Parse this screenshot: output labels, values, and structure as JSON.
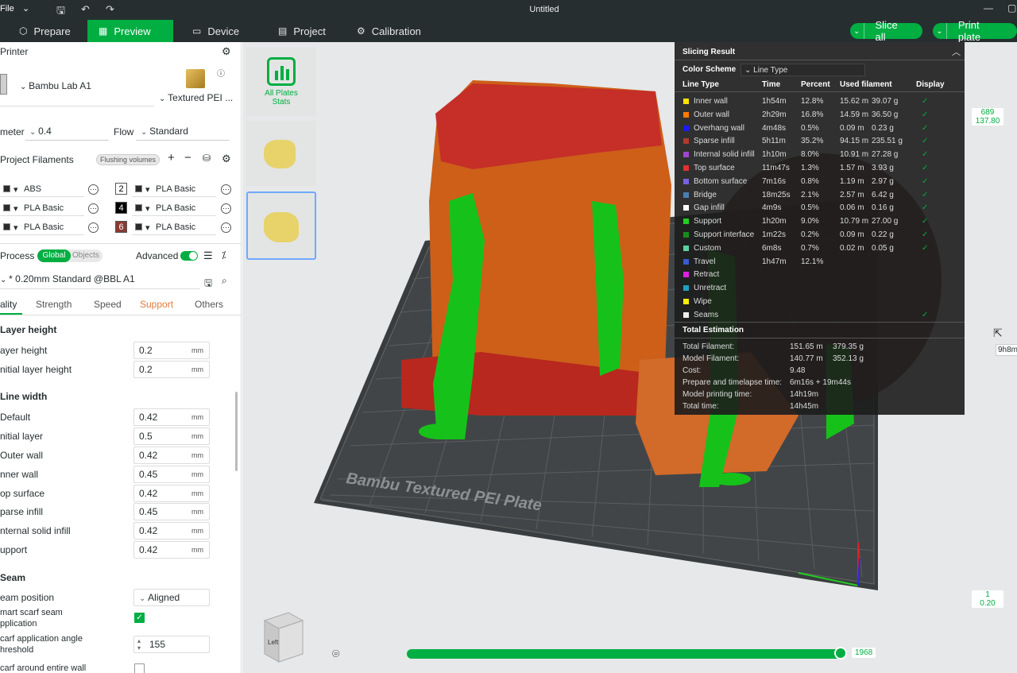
{
  "topbar": {
    "file": "File",
    "title": "Untitled"
  },
  "tabs": [
    "Prepare",
    "Preview",
    "Device",
    "Project",
    "Calibration"
  ],
  "actions": {
    "slice_all": "Slice all",
    "print_plate": "Print plate"
  },
  "printer": {
    "section": "Printer",
    "name": "Bambu Lab A1",
    "plate": "Textured PEI ...",
    "nozzle_label": "meter",
    "nozzle": "0.4",
    "flow_label": "Flow",
    "flow": "Standard"
  },
  "filaments": {
    "section": "Project Filaments",
    "flushing": "Flushing volumes",
    "items": [
      {
        "name": "ABS",
        "color": "#2a2a2a"
      },
      {
        "name": "PLA Basic",
        "color": "#2a2a2a",
        "num": "2",
        "num_color": "#ffffff"
      },
      {
        "name": "PLA Basic",
        "color": "#2a2a2a",
        "num": "4",
        "num_color": "#000000"
      },
      {
        "name": "PLA Basic",
        "color": "#2a2a2a"
      },
      {
        "name": "PLA Basic",
        "color": "#2a2a2a",
        "num": "6",
        "num_color": "#8a3a33"
      },
      {
        "name": "PLA Basic",
        "color": "#2a2a2a"
      }
    ]
  },
  "process": {
    "section": "Process",
    "global": "Global",
    "objects": "Objects",
    "advanced": "Advanced",
    "preset": "* 0.20mm Standard @BBL A1",
    "tabs": [
      "ality",
      "Strength",
      "Speed",
      "Support",
      "Others"
    ]
  },
  "params": {
    "layer_height": {
      "title": "Layer height",
      "rows": [
        {
          "label": "ayer height",
          "value": "0.2",
          "unit": "mm"
        },
        {
          "label": "nitial layer height",
          "value": "0.2",
          "unit": "mm"
        }
      ]
    },
    "line_width": {
      "title": "Line width",
      "rows": [
        {
          "label": "Default",
          "value": "0.42",
          "unit": "mm"
        },
        {
          "label": "nitial layer",
          "value": "0.5",
          "unit": "mm"
        },
        {
          "label": "Outer wall",
          "value": "0.42",
          "unit": "mm"
        },
        {
          "label": "nner wall",
          "value": "0.45",
          "unit": "mm"
        },
        {
          "label": "op surface",
          "value": "0.42",
          "unit": "mm"
        },
        {
          "label": "parse infill",
          "value": "0.45",
          "unit": "mm"
        },
        {
          "label": "nternal solid infill",
          "value": "0.42",
          "unit": "mm"
        },
        {
          "label": "upport",
          "value": "0.42",
          "unit": "mm"
        }
      ]
    },
    "seam": {
      "title": "Seam",
      "position_label": "eam position",
      "position": "Aligned",
      "scarf_label": "mart scarf seam",
      "scarf_label2": "pplication",
      "angle_label": "carf application angle",
      "angle_label2": "hreshold",
      "angle": "155",
      "around_label": "carf around entire wall"
    }
  },
  "plates": {
    "all_stats_1": "All Plates",
    "all_stats_2": "Stats"
  },
  "slicing": {
    "title": "Slicing Result",
    "scheme_label": "Color Scheme",
    "scheme": "Line Type",
    "headers": [
      "Line Type",
      "Time",
      "Percent",
      "Used filament",
      "Display"
    ],
    "rows": [
      {
        "name": "Inner wall",
        "color": "#ffe000",
        "time": "1h54m",
        "percent": "12.8%",
        "len": "15.62 m",
        "weight": "39.07 g",
        "display": true
      },
      {
        "name": "Outer wall",
        "color": "#ff7a00",
        "time": "2h29m",
        "percent": "16.8%",
        "len": "14.59 m",
        "weight": "36.50 g",
        "display": true
      },
      {
        "name": "Overhang wall",
        "color": "#1a1aff",
        "time": "4m48s",
        "percent": "0.5%",
        "len": "0.09 m",
        "weight": "0.23 g",
        "display": true
      },
      {
        "name": "Sparse infill",
        "color": "#b03a2e",
        "time": "5h11m",
        "percent": "35.2%",
        "len": "94.15 m",
        "weight": "235.51 g",
        "display": true
      },
      {
        "name": "Internal solid infill",
        "color": "#a045d0",
        "time": "1h10m",
        "percent": "8.0%",
        "len": "10.91 m",
        "weight": "27.28 g",
        "display": true
      },
      {
        "name": "Top surface",
        "color": "#e03030",
        "time": "11m47s",
        "percent": "1.3%",
        "len": "1.57 m",
        "weight": "3.93 g",
        "display": true
      },
      {
        "name": "Bottom surface",
        "color": "#7a5fe0",
        "time": "7m16s",
        "percent": "0.8%",
        "len": "1.19 m",
        "weight": "2.97 g",
        "display": true
      },
      {
        "name": "Bridge",
        "color": "#4a7fb0",
        "time": "18m25s",
        "percent": "2.1%",
        "len": "2.57 m",
        "weight": "6.42 g",
        "display": true
      },
      {
        "name": "Gap infill",
        "color": "#ffffff",
        "time": "4m9s",
        "percent": "0.5%",
        "len": "0.06 m",
        "weight": "0.16 g",
        "display": true
      },
      {
        "name": "Support",
        "color": "#22cc22",
        "time": "1h20m",
        "percent": "9.0%",
        "len": "10.79 m",
        "weight": "27.00 g",
        "display": true
      },
      {
        "name": "Support interface",
        "color": "#1a8a1a",
        "time": "1m22s",
        "percent": "0.2%",
        "len": "0.09 m",
        "weight": "0.22 g",
        "display": true
      },
      {
        "name": "Custom",
        "color": "#5fd0a0",
        "time": "6m8s",
        "percent": "0.7%",
        "len": "0.02 m",
        "weight": "0.05 g",
        "display": true
      },
      {
        "name": "Travel",
        "color": "#3a5ad0",
        "time": "1h47m",
        "percent": "12.1%",
        "len": "",
        "weight": "",
        "display": false
      },
      {
        "name": "Retract",
        "color": "#e020e0",
        "time": "",
        "percent": "",
        "len": "",
        "weight": "",
        "display": false
      },
      {
        "name": "Unretract",
        "color": "#20a0c0",
        "time": "",
        "percent": "",
        "len": "",
        "weight": "",
        "display": false
      },
      {
        "name": "Wipe",
        "color": "#ffee00",
        "time": "",
        "percent": "",
        "len": "",
        "weight": "",
        "display": false
      },
      {
        "name": "Seams",
        "color": "#eeeeee",
        "time": "",
        "percent": "",
        "len": "",
        "weight": "",
        "display": true
      }
    ],
    "total_title": "Total Estimation",
    "totals": [
      {
        "label": "Total Filament:",
        "value": "151.65 m",
        "value2": "379.35 g"
      },
      {
        "label": "Model Filament:",
        "value": "140.77 m",
        "value2": "352.13 g"
      },
      {
        "label": "Cost:",
        "value": "9.48",
        "value2": ""
      },
      {
        "label": "Prepare and timelapse time:",
        "value": "6m16s + 19m44s",
        "value2": ""
      },
      {
        "label": "Model printing time:",
        "value": "14h19m",
        "value2": ""
      },
      {
        "label": "Total time:",
        "value": "14h45m",
        "value2": ""
      }
    ]
  },
  "viewport": {
    "plate_label": "Bambu Textured PEI Plate",
    "layer_top_1": "689",
    "layer_top_2": "137.80",
    "layer_bot_1": "1",
    "layer_bot_2": "0.20",
    "slider_value": "1968",
    "tooltip": "9h8m",
    "cube_label": "Left"
  }
}
